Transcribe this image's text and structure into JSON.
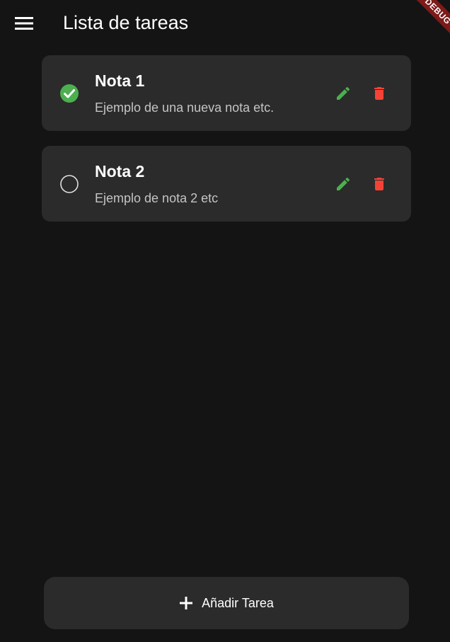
{
  "app_bar": {
    "title": "Lista de tareas",
    "menu_icon": "menu-icon"
  },
  "debug_banner": {
    "label": "DEBUG",
    "color": "#7d1a1a"
  },
  "tasks": [
    {
      "title": "Nota 1",
      "description": "Ejemplo de una nueva nota etc.",
      "completed": true,
      "status_icon": "check-circle-icon",
      "edit_icon": "edit-icon",
      "delete_icon": "delete-icon"
    },
    {
      "title": "Nota 2",
      "description": "Ejemplo de nota 2 etc",
      "completed": false,
      "status_icon": "circle-outline-icon",
      "edit_icon": "edit-icon",
      "delete_icon": "delete-icon"
    }
  ],
  "add_button": {
    "label": "Añadir Tarea",
    "icon": "add-icon"
  },
  "colors": {
    "background": "#141414",
    "card": "#2b2b2b",
    "check_green": "#4caf50",
    "edit_green": "#4caf50",
    "delete_red": "#f44336",
    "text_primary": "#ffffff",
    "text_secondary": "#c4c4c4"
  }
}
